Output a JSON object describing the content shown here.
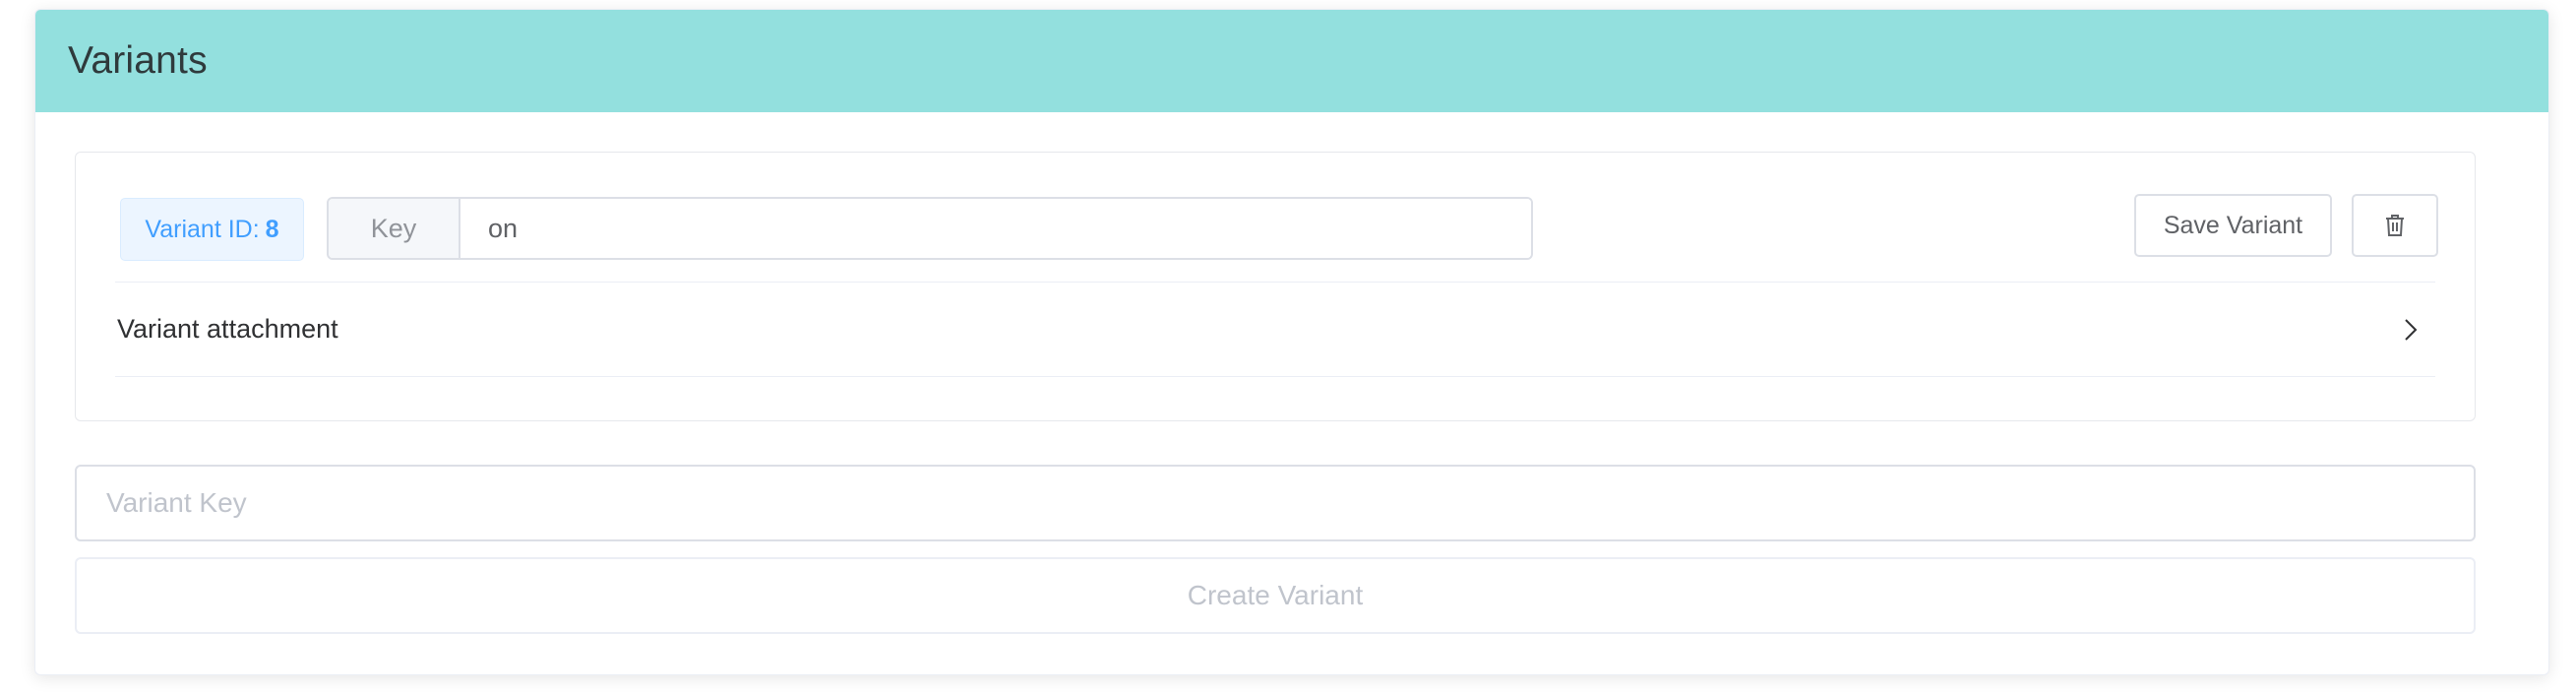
{
  "card": {
    "title": "Variants"
  },
  "variant": {
    "id_label": "Variant ID:",
    "id_value": "8",
    "key_label": "Key",
    "key_value": "on",
    "save_label": "Save Variant",
    "delete_icon": "trash-icon",
    "attachment_label": "Variant attachment",
    "attachment_icon": "chevron-right-icon"
  },
  "create": {
    "key_placeholder": "Variant Key",
    "button_label": "Create Variant"
  },
  "colors": {
    "header_bg": "#93e0de",
    "tag_bg": "#ecf5ff",
    "tag_text": "#409eff",
    "border": "#dcdfe6",
    "disabled_text": "#c0c4cc"
  }
}
